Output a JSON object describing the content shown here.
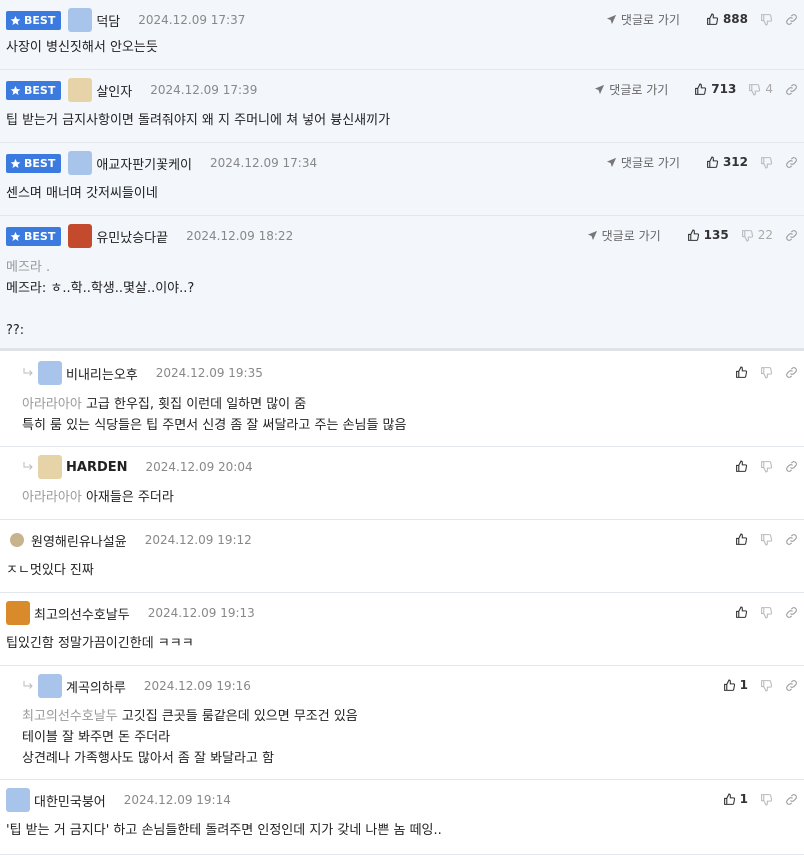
{
  "labels": {
    "best": "BEST",
    "goto": "댓글로 가기"
  },
  "comments": [
    {
      "nick": "덕담",
      "date": "2024.12.09 17:37",
      "likes": "888",
      "dislikes": "",
      "lines": [
        "사장이 병신짓해서 안오는듯"
      ]
    },
    {
      "nick": "살인자",
      "date": "2024.12.09 17:39",
      "likes": "713",
      "dislikes": "4",
      "lines": [
        "팁 받는거 금지사항이면 돌려줘야지 왜 지 주머니에 쳐 넣어 븅신새끼가"
      ]
    },
    {
      "nick": "애교자판기꽃케이",
      "date": "2024.12.09 17:34",
      "likes": "312",
      "dislikes": "",
      "lines": [
        "센스며 매너며 갓저씨들이네"
      ]
    },
    {
      "nick": "유민났승다끝",
      "date": "2024.12.09 18:22",
      "likes": "135",
      "dislikes": "22",
      "quote": "메즈라 .",
      "lines": [
        "메즈라: ㅎ..학..학생..몇살..이야..?",
        "",
        "??:"
      ]
    },
    {
      "nick": "비내리는오후",
      "date": "2024.12.09 19:35",
      "quote": "아라라아아",
      "lines": [
        "고급 한우집, 횟집 이런데 일하면 많이 줌",
        "특히 룸 있는 식당들은 팁 주면서 신경 좀 잘 써달라고 주는 손님들 많음"
      ]
    },
    {
      "nick": "HARDEN",
      "date": "2024.12.09 20:04",
      "quote": "아라라아아",
      "lines": [
        "아재들은 주더라"
      ]
    },
    {
      "nick": "원영해린유나설윤",
      "date": "2024.12.09 19:12",
      "lines": [
        "ㅈㄴ멋있다 진짜"
      ]
    },
    {
      "nick": "최고의선수호날두",
      "date": "2024.12.09 19:13",
      "lines": [
        "팁있긴함 정말가끔이긴한데 ㅋㅋㅋ"
      ]
    },
    {
      "nick": "계곡의하루",
      "date": "2024.12.09 19:16",
      "likes": "1",
      "quote": "최고의선수호날두",
      "lines": [
        "고깃집 큰곳들 룸같은데 있으면 무조건 있음",
        "테이블 잘 봐주면 돈 주더라",
        "상견례나 가족행사도 많아서 좀 잘 봐달라고 함"
      ]
    },
    {
      "nick": "대한민국붕어",
      "date": "2024.12.09 19:14",
      "likes": "1",
      "lines": [
        "'팁 받는 거 금지다' 하고 손님들한테 돌려주면 인정인데 지가 갖네 나쁜 놈 떼잉.."
      ]
    }
  ],
  "icons": [
    "star-icon",
    "thumbs-up-icon",
    "thumbs-down-icon",
    "link-icon",
    "send-icon",
    "reply-arrow-icon"
  ],
  "colors": {
    "best_badge": "#3b7be0",
    "best_bg": "#f3f6fb",
    "quote": "#999999"
  }
}
